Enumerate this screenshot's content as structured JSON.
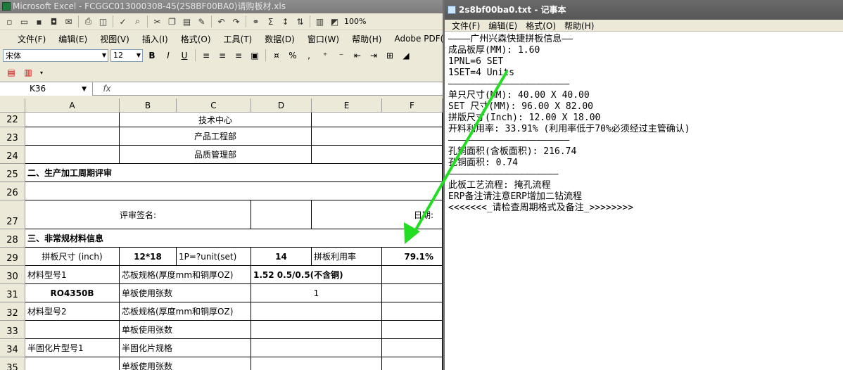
{
  "excel": {
    "title": "Microsoft Excel - FCGGC013000308-45(2S8BF00BA0)请购板材.xls",
    "toolbar": {
      "zoom": "100%"
    },
    "menu": [
      "文件(F)",
      "编辑(E)",
      "视图(V)",
      "插入(I)",
      "格式(O)",
      "工具(T)",
      "数据(D)",
      "窗口(W)",
      "帮助(H)",
      "Adobe PDF(B)"
    ],
    "font_name": "宋体",
    "font_size": "12",
    "name_box": "K36",
    "fx_label": "fx",
    "columns": [
      "A",
      "B",
      "C",
      "D",
      "E",
      "F"
    ],
    "rows": [
      {
        "num": "22",
        "b": "技术中心"
      },
      {
        "num": "23",
        "b": "产品工程部"
      },
      {
        "num": "24",
        "b": "品质管理部"
      },
      {
        "num": "25",
        "a": "二、生产加工周期评审"
      },
      {
        "num": "26"
      },
      {
        "num": "27",
        "a": "评审签名:",
        "e": "日期:"
      },
      {
        "num": "28",
        "a": "三、非常规材料信息"
      },
      {
        "num": "29",
        "a": "拼板尺寸 (inch)",
        "b": "12*18",
        "c": "1P=?unit(set)",
        "d": "14",
        "e": "拼板利用率",
        "f": "79.1%"
      },
      {
        "num": "30",
        "a": "材料型号1",
        "b": "芯板规格(厚度mm和铜厚OZ)",
        "d": "1.52 0.5/0.5(不含铜)"
      },
      {
        "num": "31",
        "a": "RO4350B",
        "b": "单板使用张数",
        "d": "1"
      },
      {
        "num": "32",
        "a": "材料型号2",
        "b": "芯板规格(厚度mm和铜厚OZ)"
      },
      {
        "num": "33",
        "b": "单板使用张数"
      },
      {
        "num": "34",
        "a": "半固化片型号1",
        "b": "半固化片规格"
      },
      {
        "num": "35",
        "b": "单板使用张数"
      }
    ]
  },
  "notepad": {
    "title": "2s8bf00ba0.txt - 记事本",
    "menu": [
      "文件(F)",
      "编辑(E)",
      "格式(O)",
      "帮助(H)"
    ],
    "lines": [
      "————广州兴森快捷拼板信息——",
      "成品板厚(MM): 1.60",
      "1PNL=6 SET",
      "1SET=4 Units",
      "——————————————————————",
      "单只尺寸(MM): 40.00 X 40.00",
      "SET 尺寸(MM): 96.00 X 82.00",
      "拼版尺寸(Inch): 12.00 X 18.00",
      "开料利用率: 33.91% (利用率低于70%必须经过主管确认)",
      "——————————————————————",
      "孔铜面积(含板面积): 216.74",
      "孔铜面积: 0.74",
      "————————————————————",
      "此板工艺流程: 掩孔流程",
      "ERP备注请注意ERP增加二钻流程",
      "<<<<<<<_请检查周期格式及备注_>>>>>>>>"
    ]
  },
  "annotation": {
    "arrow_color": "#22dd22"
  }
}
